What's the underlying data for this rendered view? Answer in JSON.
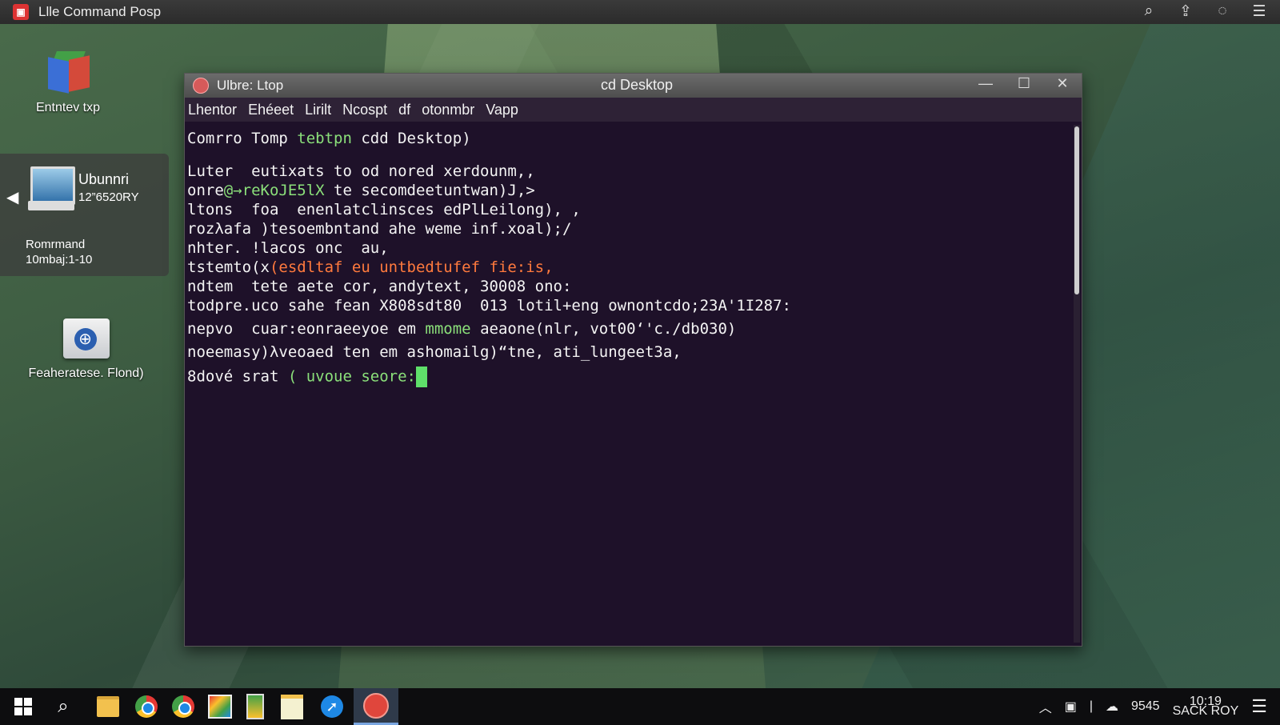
{
  "topbar": {
    "app_title": "Llle Command Posp",
    "tools": [
      "search-icon",
      "share-icon",
      "bulb-icon",
      "menu-icon"
    ]
  },
  "desktop": {
    "icon1_label": "Entntev txp",
    "panel_title": "Ubunnri",
    "panel_sub": "12”6520RY",
    "panel_caption1": "Romrmand",
    "panel_caption2": "10mbaj:1-10",
    "folder_label": "Feaheratese. Flond)"
  },
  "window": {
    "title_left": "Ulbre: Ltop",
    "title_center": "cd Desktop",
    "menu": [
      "Lhentor",
      "Ehéeet",
      "Lirilt",
      "Ncospt",
      "df",
      "otonmbr",
      "Vapp"
    ]
  },
  "terminal": {
    "l1a": "Comrro Tomp ",
    "l1b": "tebtpn",
    "l1c": " cdd Desktop)",
    "l2": "Luter  eutixats to od nored xerdounm,,",
    "l3a": "onre",
    "l3b": "@→reKoJE5lX",
    "l3c": " te secomdeetuntwan)J,>",
    "l4": "ltons  foa  enenlatclinsces edPlLeilong), ,",
    "l5": "rozλafa )tesoembntand ahe weme inf.xoal);/",
    "l6": "nhter. !lacos onc  au,",
    "l7a": "tstemto(x",
    "l7b": "(esdltaf eu untbedtufef fie:is,",
    "l8": "ndtem  tete aete cor, andytext, 30008 ono:",
    "l9": "todpre.uco sahe fean X808sdt80  013 lotil+eng ownontcdo;23A'1I287:",
    "l10a": "nepvo  cuar:eonraeeyoe em ",
    "l10b": "mmome",
    "l10c": " aeaone(nlr, vot00‘'c./db030)",
    "l11": "noeemasy)λveoaed ten em ashomailg)“tne, ati_lungeet3a,",
    "l12a": "8dové srat ",
    "l12b": "( uvoue seore:"
  },
  "taskbar": {
    "apps": [
      "windows-start-icon",
      "search-icon",
      "file-explorer-icon",
      "chrome-icon",
      "chrome-icon",
      "photos-icon",
      "office-icon",
      "notes-icon",
      "edge-icon",
      "terminal-icon"
    ],
    "tray_num": "9545",
    "tray_time": "10:19",
    "tray_date": "SACK ROY"
  },
  "colors": {
    "terminal_bg": "#1e1129",
    "prompt_green": "#8be07a",
    "error_orange": "#ff7a3d",
    "cursor_green": "#5fe06a"
  }
}
